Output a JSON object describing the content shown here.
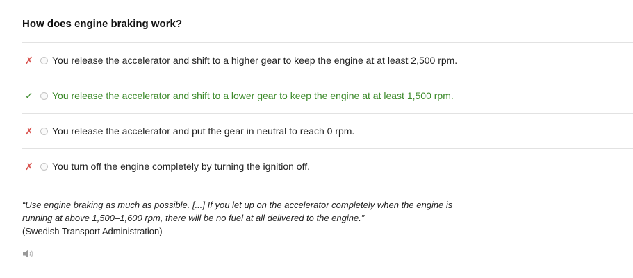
{
  "question": {
    "title": "How does engine braking work?"
  },
  "options": [
    {
      "mark": "✗",
      "status": "wrong",
      "text": "You release the accelerator and shift to a higher gear to keep the engine at at least 2,500 rpm."
    },
    {
      "mark": "✓",
      "status": "correct",
      "text": "You release the accelerator and shift to a lower gear to keep the engine at at least 1,500 rpm."
    },
    {
      "mark": "✗",
      "status": "wrong",
      "text": "You release the accelerator and put the gear in neutral to reach 0 rpm."
    },
    {
      "mark": "✗",
      "status": "wrong",
      "text": "You turn off the engine completely by turning the ignition off."
    }
  ],
  "explanation": {
    "quote": "“Use engine braking as much as possible. [...] If you let up on the accelerator completely when the engine is running at above 1,500–1,600 rpm, there will be no fuel at all delivered to the engine.”",
    "source": "(Swedish Transport Administration)"
  },
  "audio": {
    "icon": "speaker-icon"
  },
  "colors": {
    "correct": "#3c8a2a",
    "wrong": "#d9534f",
    "divider": "#e2e2e2"
  }
}
